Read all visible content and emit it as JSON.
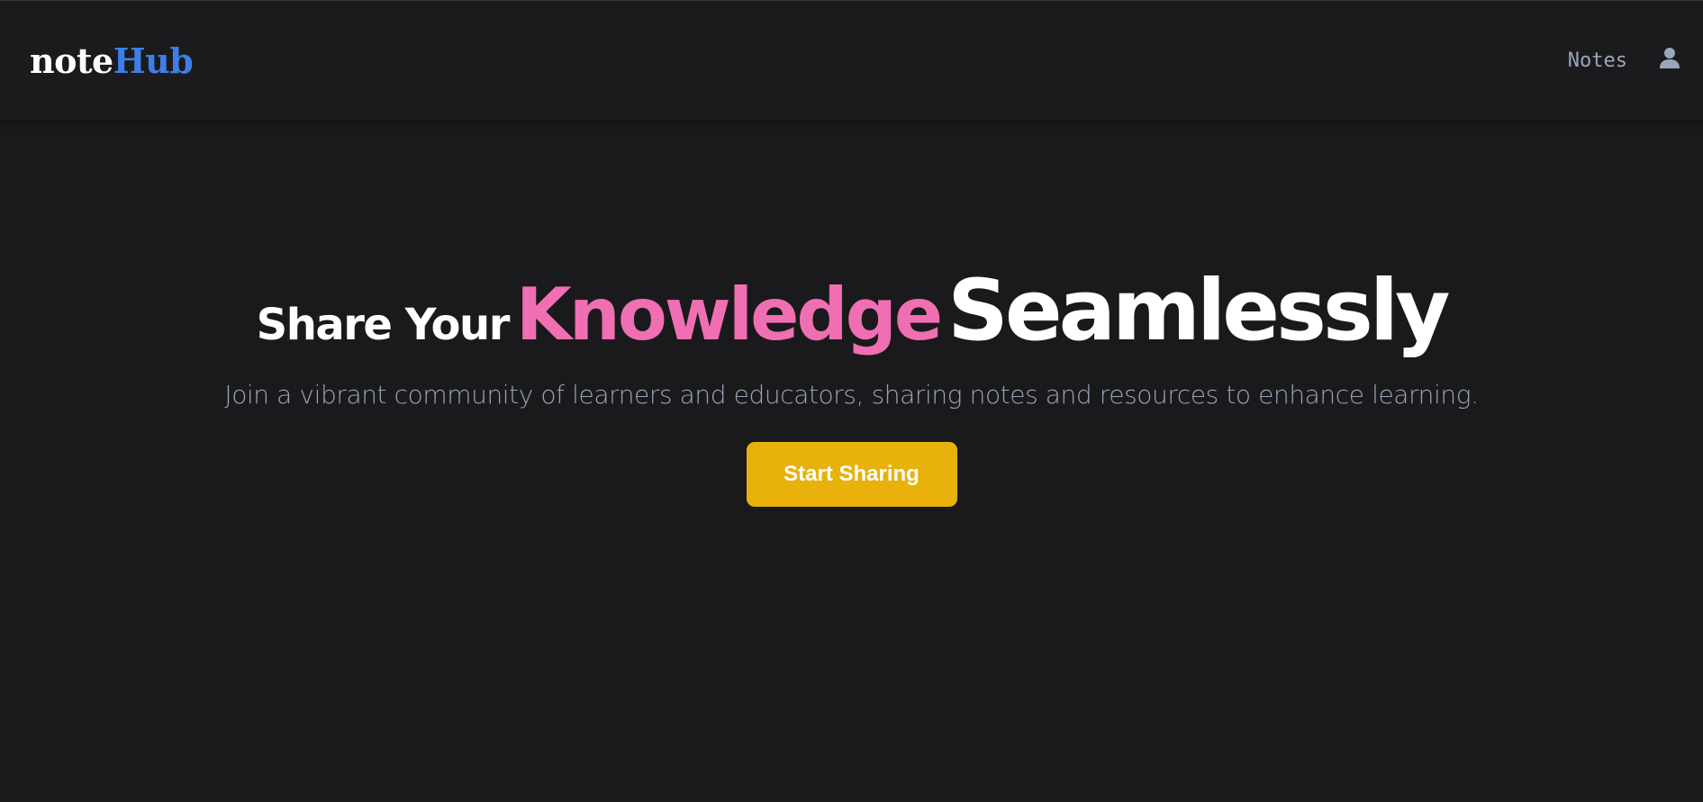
{
  "navbar": {
    "logo_part1": "note",
    "logo_part2": "Hub",
    "links": [
      {
        "label": "Notes"
      }
    ],
    "user_icon": "user-icon"
  },
  "hero": {
    "headline_part1": "Share Your",
    "headline_part2": "Knowledge",
    "headline_part3": "Seamlessly",
    "subtitle": "Join a vibrant community of learners and educators, sharing notes and resources to enhance learning.",
    "cta_label": "Start Sharing"
  },
  "colors": {
    "background": "#1a1a1c",
    "logo_accent": "#3f7ee6",
    "headline_accent": "#f06fb3",
    "cta_background": "#e8b10b",
    "subtitle": "#98a4ba"
  }
}
